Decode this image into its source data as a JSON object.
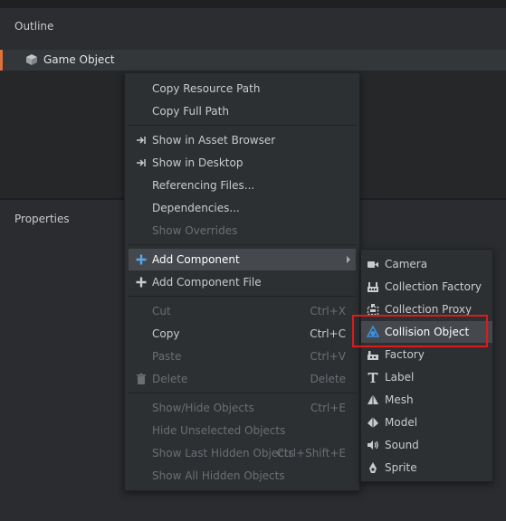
{
  "outline": {
    "title": "Outline",
    "root_item": {
      "label": "Game Object",
      "icon": "cube-icon"
    }
  },
  "properties": {
    "title": "Properties"
  },
  "context_menu": {
    "items": [
      {
        "label": "Copy Resource Path",
        "enabled": true
      },
      {
        "label": "Copy Full Path",
        "enabled": true
      },
      {
        "label": "Show in Asset Browser",
        "enabled": true,
        "icon": "reveal-arrow-icon"
      },
      {
        "label": "Show in Desktop",
        "enabled": true,
        "icon": "reveal-arrow-icon"
      },
      {
        "label": "Referencing Files...",
        "enabled": true
      },
      {
        "label": "Dependencies...",
        "enabled": true
      },
      {
        "label": "Show Overrides",
        "enabled": false
      },
      {
        "label": "Add Component",
        "enabled": true,
        "icon": "plus-icon",
        "submenu": true,
        "highlighted": true
      },
      {
        "label": "Add Component File",
        "enabled": true,
        "icon": "plus-icon"
      },
      {
        "label": "Cut",
        "shortcut": "Ctrl+X",
        "enabled": false
      },
      {
        "label": "Copy",
        "shortcut": "Ctrl+C",
        "enabled": true
      },
      {
        "label": "Paste",
        "shortcut": "Ctrl+V",
        "enabled": false
      },
      {
        "label": "Delete",
        "shortcut": "Delete",
        "enabled": false,
        "icon": "trash-icon"
      },
      {
        "label": "Show/Hide Objects",
        "shortcut": "Ctrl+E",
        "enabled": false
      },
      {
        "label": "Hide Unselected Objects",
        "enabled": false
      },
      {
        "label": "Show Last Hidden Objects",
        "shortcut": "Ctrl+Shift+E",
        "enabled": false
      },
      {
        "label": "Show All Hidden Objects",
        "enabled": false
      }
    ]
  },
  "component_submenu": {
    "items": [
      {
        "label": "Camera",
        "icon": "camera-icon"
      },
      {
        "label": "Collection Factory",
        "icon": "collection-factory-icon"
      },
      {
        "label": "Collection Proxy",
        "icon": "collection-proxy-icon"
      },
      {
        "label": "Collision Object",
        "icon": "collision-object-icon",
        "highlighted": true
      },
      {
        "label": "Factory",
        "icon": "factory-icon"
      },
      {
        "label": "Label",
        "icon": "label-icon"
      },
      {
        "label": "Mesh",
        "icon": "mesh-icon"
      },
      {
        "label": "Model",
        "icon": "model-icon"
      },
      {
        "label": "Sound",
        "icon": "sound-icon"
      },
      {
        "label": "Sprite",
        "icon": "sprite-icon"
      }
    ]
  },
  "colors": {
    "accent_selection": "#d9733f",
    "highlight_box": "#e0191b",
    "add_icon_blue": "#55a9ec",
    "collision_icon_blue": "#3d8fe0"
  }
}
